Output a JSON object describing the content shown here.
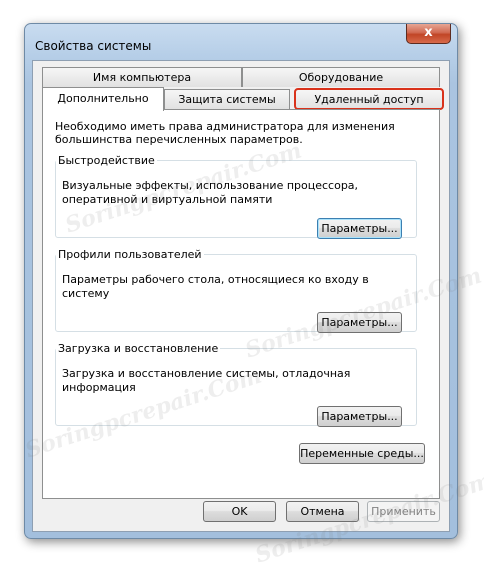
{
  "window": {
    "title": "Свойства системы",
    "close_label": "x"
  },
  "tabs": {
    "row_back": [
      {
        "label": "Имя компьютера"
      },
      {
        "label": "Оборудование"
      }
    ],
    "row_front": [
      {
        "label": "Дополнительно",
        "active": true
      },
      {
        "label": "Защита системы"
      },
      {
        "label": "Удаленный доступ",
        "highlighted": true
      }
    ]
  },
  "panel": {
    "note": "Необходимо иметь права администратора для изменения большинства перечисленных параметров.",
    "performance": {
      "title": "Быстродействие",
      "desc": "Визуальные эффекты, использование процессора, оперативной и виртуальной памяти",
      "button": "Параметры..."
    },
    "profiles": {
      "title": "Профили пользователей",
      "desc": "Параметры рабочего стола, относящиеся ко входу в систему",
      "button": "Параметры..."
    },
    "startup": {
      "title": "Загрузка и восстановление",
      "desc": "Загрузка и восстановление системы, отладочная информация",
      "button": "Параметры..."
    },
    "env_button": "Переменные среды..."
  },
  "footer": {
    "ok": "OK",
    "cancel": "Отмена",
    "apply": "Применить"
  },
  "watermark": "Soringpcrepair.Com",
  "colors": {
    "highlight_outline": "#d9321b",
    "window_frame": "#aac4e0"
  }
}
